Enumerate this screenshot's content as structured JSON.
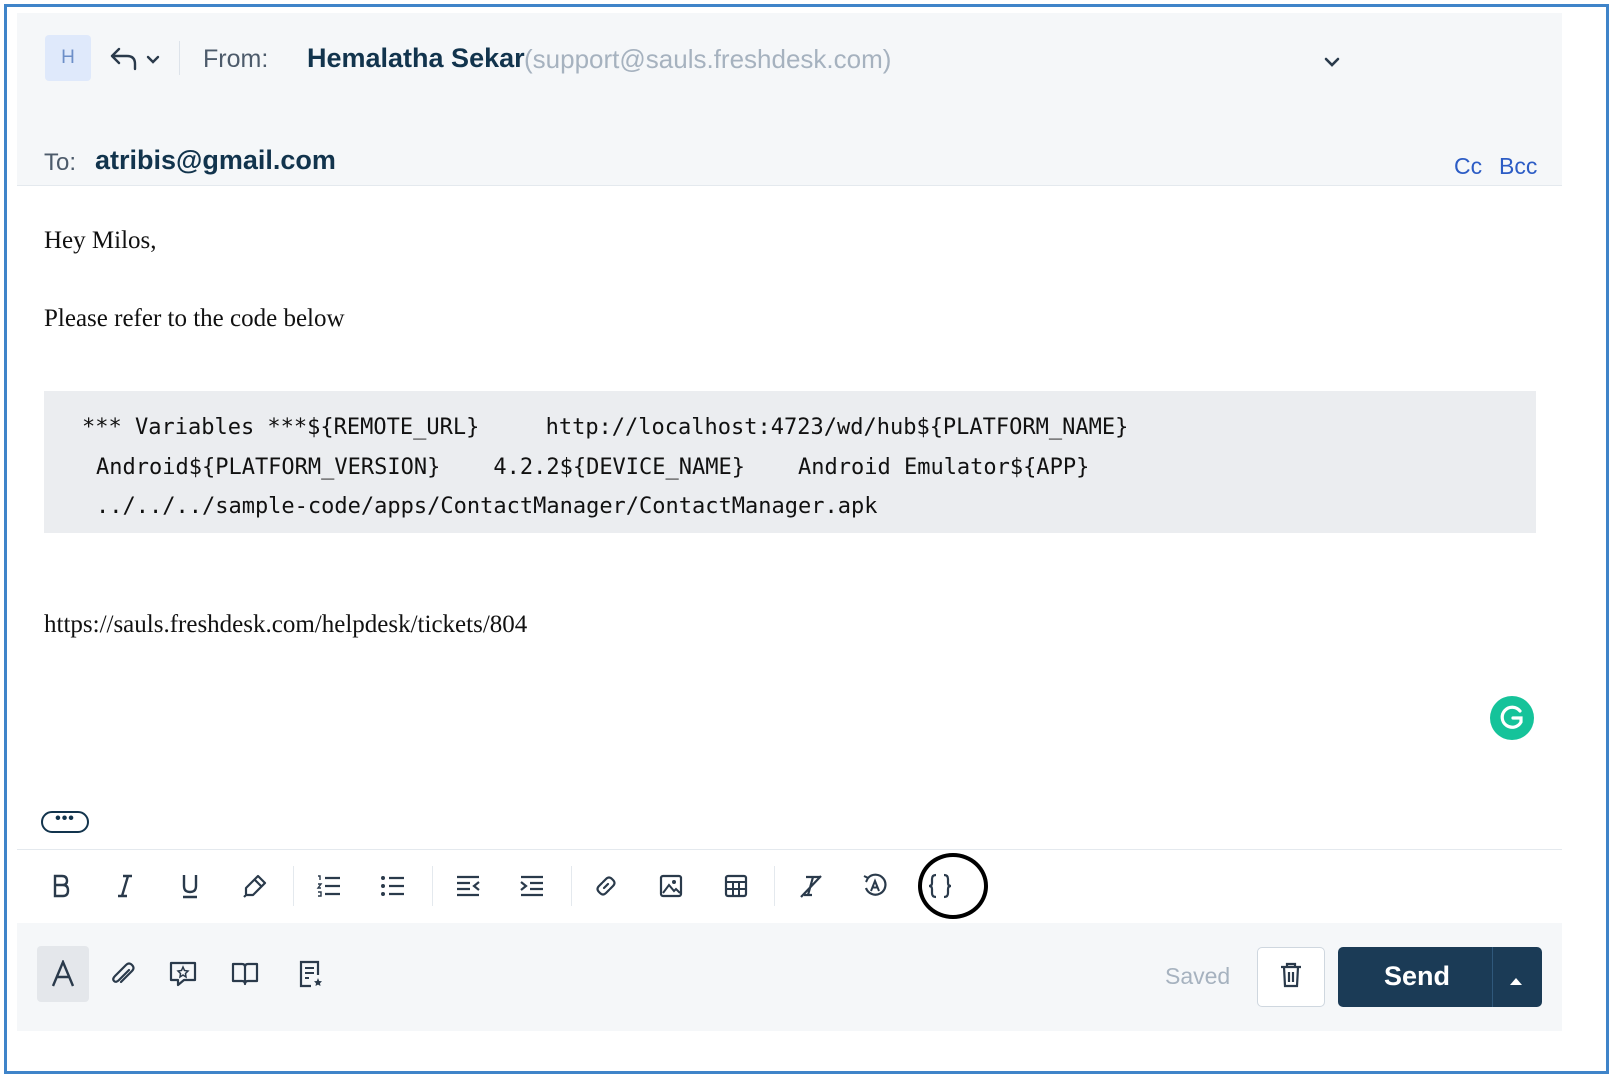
{
  "header": {
    "avatar_initial": "H",
    "from_label": "From:",
    "from_name": "Hemalatha Sekar",
    "from_email": "(support@sauls.freshdesk.com)",
    "to_label": "To:",
    "to_value": "atribis@gmail.com",
    "cc_label": "Cc",
    "bcc_label": "Bcc"
  },
  "body": {
    "greeting": "Hey Milos,",
    "intro": "Please refer to the code below",
    "code_lines": [
      "*** Variables ***${REMOTE_URL}     http://localhost:4723/wd/hub${PLATFORM_NAME}",
      "Android${PLATFORM_VERSION}    4.2.2${DEVICE_NAME}    Android Emulator${APP}",
      "../../../sample-code/apps/ContactManager/ContactManager.apk"
    ],
    "link": "https://sauls.freshdesk.com/helpdesk/tickets/804",
    "more_label": "•••"
  },
  "toolbar": {
    "icons": [
      "bold-icon",
      "italic-icon",
      "underline-icon",
      "highlight-icon",
      "numbered-list-icon",
      "bullet-list-icon",
      "outdent-icon",
      "indent-icon",
      "link-icon",
      "image-icon",
      "table-icon",
      "clear-format-icon",
      "spellcheck-icon",
      "code-icon"
    ]
  },
  "footer": {
    "saved_label": "Saved",
    "send_label": "Send"
  },
  "colors": {
    "accent": "#2c5cc5",
    "send_bg": "#1b3b56",
    "grammarly": "#15c39a",
    "header_bg": "#f5f7f9",
    "code_bg": "#ebedf0"
  }
}
